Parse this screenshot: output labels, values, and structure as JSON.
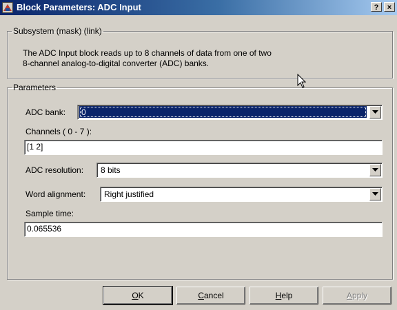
{
  "window": {
    "title": "Block Parameters: ADC Input",
    "help_glyph": "?",
    "close_glyph": "×",
    "icon": "simulink-block-icon"
  },
  "mask_group": {
    "legend": "Subsystem (mask) (link)",
    "description_line1": "The ADC Input block reads up to 8 channels of data from one of two",
    "description_line2": "8-channel analog-to-digital converter (ADC) banks."
  },
  "params_group": {
    "legend": "Parameters",
    "adc_bank": {
      "label": "ADC bank:",
      "value": "0"
    },
    "channels": {
      "label": "Channels ( 0 - 7 ):",
      "value": "[1 2]"
    },
    "adc_resolution": {
      "label": "ADC resolution:",
      "value": "8 bits"
    },
    "word_alignment": {
      "label": "Word alignment:",
      "value": "Right justified"
    },
    "sample_time": {
      "label": "Sample time:",
      "value": "0.065536"
    }
  },
  "buttons": {
    "ok_acc": "O",
    "ok_rest": "K",
    "cancel_acc": "C",
    "cancel_rest": "ancel",
    "help_acc": "H",
    "help_rest": "elp",
    "apply_acc": "A",
    "apply_rest": "pply"
  },
  "colors": {
    "titlebar_start": "#0a246a",
    "titlebar_end": "#a6caf0",
    "face": "#d4d0c8",
    "selection": "#0a246a"
  }
}
